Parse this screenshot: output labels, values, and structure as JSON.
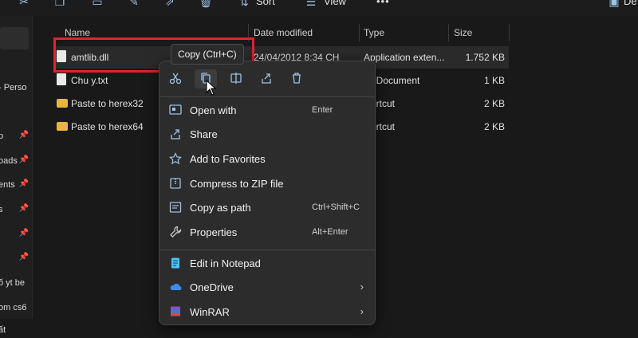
{
  "toolbar": {
    "sort_label": "Sort",
    "view_label": "View",
    "more_label": "•••",
    "details_label": "De"
  },
  "sidebar": {
    "items": [
      {
        "label": "- Perso",
        "pinned": false
      },
      {
        "label": "p",
        "pinned": true
      },
      {
        "label": "oads",
        "pinned": true
      },
      {
        "label": "ents",
        "pinned": true
      },
      {
        "label": "s",
        "pinned": true
      },
      {
        "label": "",
        "pinned": true
      },
      {
        "label": "",
        "pinned": true
      },
      {
        "label": "ố yt be",
        "pinned": false
      },
      {
        "label": "om cs6",
        "pinned": false
      },
      {
        "label": "ất",
        "pinned": false
      }
    ]
  },
  "columns": {
    "name": "Name",
    "date_modified": "Date modified",
    "type": "Type",
    "size": "Size"
  },
  "files": [
    {
      "name": "amtlib.dll",
      "date": "24/04/2012 8:34 CH",
      "type": "Application exten...",
      "size": "1.752 KB",
      "icon": "dll-file-icon"
    },
    {
      "name": "Chu y.txt",
      "date": "",
      "type": "t Document",
      "size": "1 KB",
      "icon": "text-file-icon"
    },
    {
      "name": "Paste to herex32",
      "date": "",
      "type": "ortcut",
      "size": "2 KB",
      "icon": "folder-shortcut-icon"
    },
    {
      "name": "Paste to herex64",
      "date": "",
      "type": "ortcut",
      "size": "2 KB",
      "icon": "folder-shortcut-icon"
    }
  ],
  "tooltip": "Copy (Ctrl+C)",
  "context_menu": {
    "quick_actions": [
      "cut-icon",
      "copy-icon",
      "rename-icon",
      "share-icon",
      "delete-icon"
    ],
    "items": [
      {
        "label": "Open with",
        "shortcut": "Enter",
        "icon": "open-with-icon"
      },
      {
        "label": "Share",
        "shortcut": "",
        "icon": "share-icon"
      },
      {
        "label": "Add to Favorites",
        "shortcut": "",
        "icon": "star-icon"
      },
      {
        "label": "Compress to ZIP file",
        "shortcut": "",
        "icon": "zip-icon"
      },
      {
        "label": "Copy as path",
        "shortcut": "Ctrl+Shift+C",
        "icon": "copy-path-icon"
      },
      {
        "label": "Properties",
        "shortcut": "Alt+Enter",
        "icon": "wrench-icon"
      },
      {
        "label": "Edit in Notepad",
        "shortcut": "",
        "icon": "notepad-icon"
      },
      {
        "label": "OneDrive",
        "shortcut": "",
        "icon": "onedrive-icon",
        "submenu": true
      },
      {
        "label": "WinRAR",
        "shortcut": "",
        "icon": "winrar-icon",
        "submenu": true
      }
    ]
  },
  "colors": {
    "accent": "#4cc2ff",
    "highlight_border": "#e0232a",
    "folder": "#e8b640"
  }
}
